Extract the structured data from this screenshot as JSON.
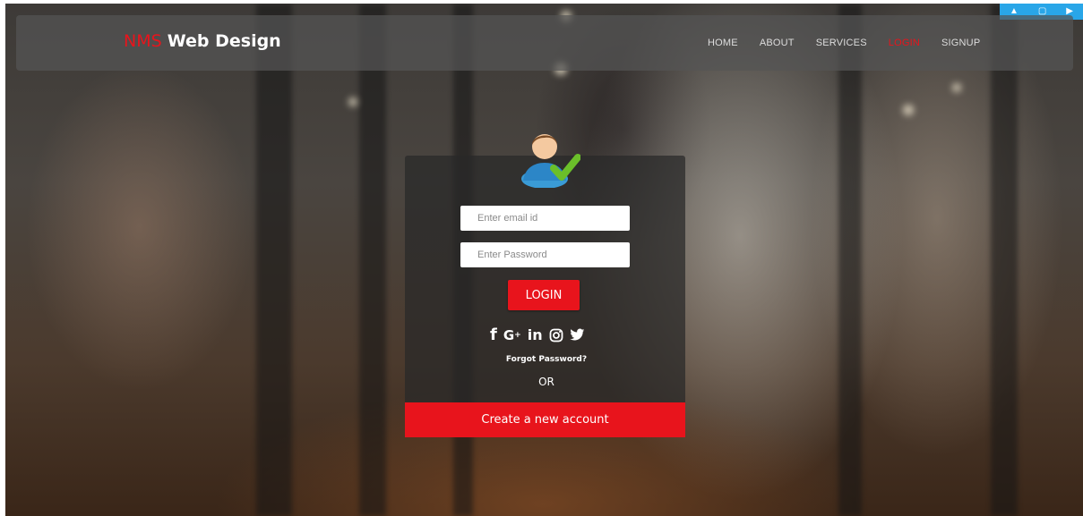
{
  "navbar": {
    "brand_accent": "NMS",
    "brand_rest": "Web Design",
    "items": [
      {
        "label": "HOME",
        "active": false
      },
      {
        "label": "ABOUT",
        "active": false
      },
      {
        "label": "SERVICES",
        "active": false
      },
      {
        "label": "LOGIN",
        "active": true
      },
      {
        "label": "SIGNUP",
        "active": false
      }
    ]
  },
  "login": {
    "email_placeholder": "Enter email id",
    "password_placeholder": "Enter Password",
    "login_label": "LOGIN",
    "social": [
      "facebook-icon",
      "google-plus-icon",
      "linkedin-icon",
      "instagram-icon",
      "twitter-icon"
    ],
    "forgot_label": "Forgot Password?",
    "or_label": "OR",
    "create_label": "Create a new account"
  },
  "colors": {
    "accent": "#e8141c",
    "navbar_bg": "#555555",
    "card_bg": "#282828"
  }
}
